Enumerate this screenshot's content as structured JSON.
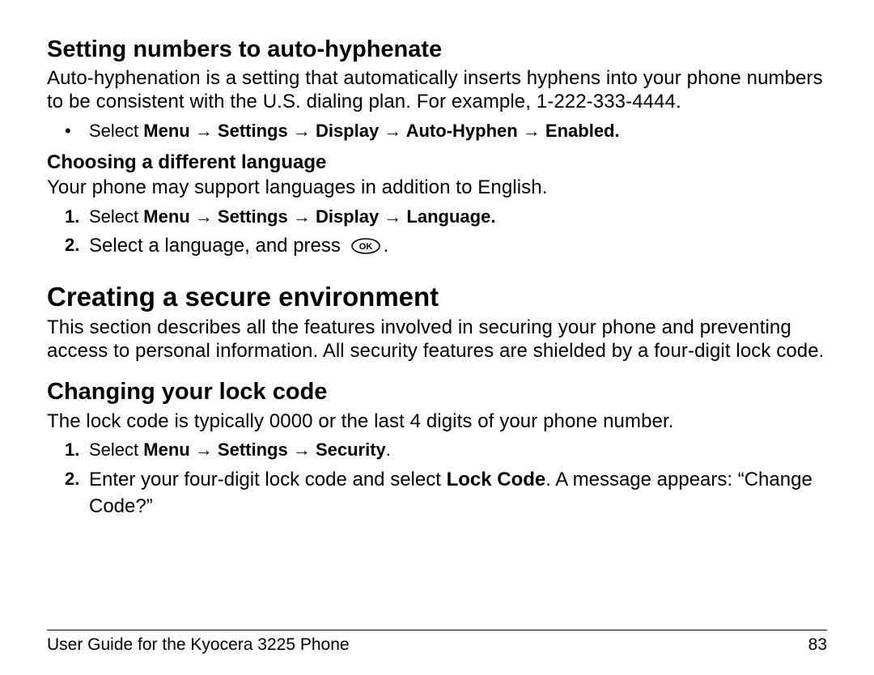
{
  "section1": {
    "title": "Setting numbers to auto-hyphenate",
    "para": "Auto-hyphenation is a setting that automatically inserts hyphens into your phone numbers to be consistent with the U.S. dialing plan. For example, 1-222-333-4444.",
    "bullet_lead": "Select ",
    "bullet_bold": "Menu → Settings → Display → Auto-Hyphen → Enabled."
  },
  "sub1": {
    "title": "Choosing a different language",
    "para": "Your phone may support languages in addition to English.",
    "step1_lead": "Select ",
    "step1_bold": "Menu → Settings → Display → Language.",
    "step2_lead": "Select a language, and press ",
    "step2_tail": "."
  },
  "section2": {
    "title": "Creating a secure environment",
    "para": "This section describes all the features involved in securing your phone and preventing access to personal information. All security features are shielded by a four-digit lock code."
  },
  "section3": {
    "title": "Changing your lock code",
    "para": "The lock code is typically 0000 or the last 4 digits of your phone number.",
    "step1_lead": "Select ",
    "step1_bold": "Menu → Settings → Security",
    "step1_tail": ".",
    "step2_a": "Enter your four-digit lock code and select ",
    "step2_bold": "Lock Code",
    "step2_b": ". A message appears: “Change Code?”"
  },
  "footer": {
    "title": "User Guide for the Kyocera 3225 Phone",
    "page": "83"
  },
  "icons": {
    "ok": "OK"
  }
}
